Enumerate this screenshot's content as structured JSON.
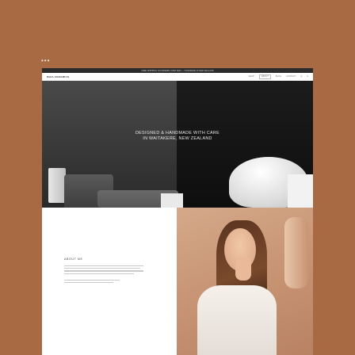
{
  "window": {
    "menu_glyph": "•••"
  },
  "site": {
    "announcement": "FREE SHIPPING ON ORDERS OVER $200 — HANDMADE IN NEW ZEALAND",
    "logo": "MAIA CERAMICS",
    "nav": [
      "SHOP",
      "ABOUT",
      "BLOG",
      "CONTACT",
      "Q",
      "♥"
    ],
    "hero": {
      "line1": "DESIGNED & HANDMADE WITH CARE",
      "line2": "IN WAITAKERE, NEW ZEALAND"
    },
    "about": {
      "title": "ABOUT ME"
    }
  }
}
